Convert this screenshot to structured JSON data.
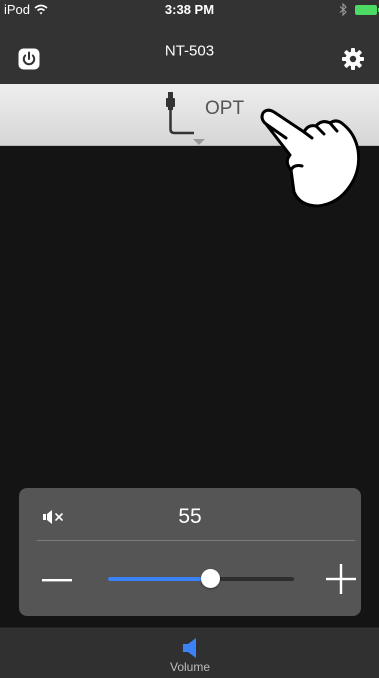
{
  "status_bar": {
    "carrier": "iPod",
    "time": "3:38 PM"
  },
  "nav": {
    "title": "NT-503"
  },
  "input_selector": {
    "label": "OPT"
  },
  "volume": {
    "value": "55",
    "level_percent": 55,
    "accent_color": "#3b82f6"
  },
  "tab_bar": {
    "volume_label": "Volume"
  },
  "icons": [
    "wifi-icon",
    "bluetooth-icon",
    "battery-icon",
    "power-icon",
    "gear-icon",
    "optical-cable-icon",
    "dropdown-arrow-icon",
    "pointing-hand-icon",
    "mute-icon",
    "minus-icon",
    "plus-icon",
    "speaker-icon"
  ]
}
